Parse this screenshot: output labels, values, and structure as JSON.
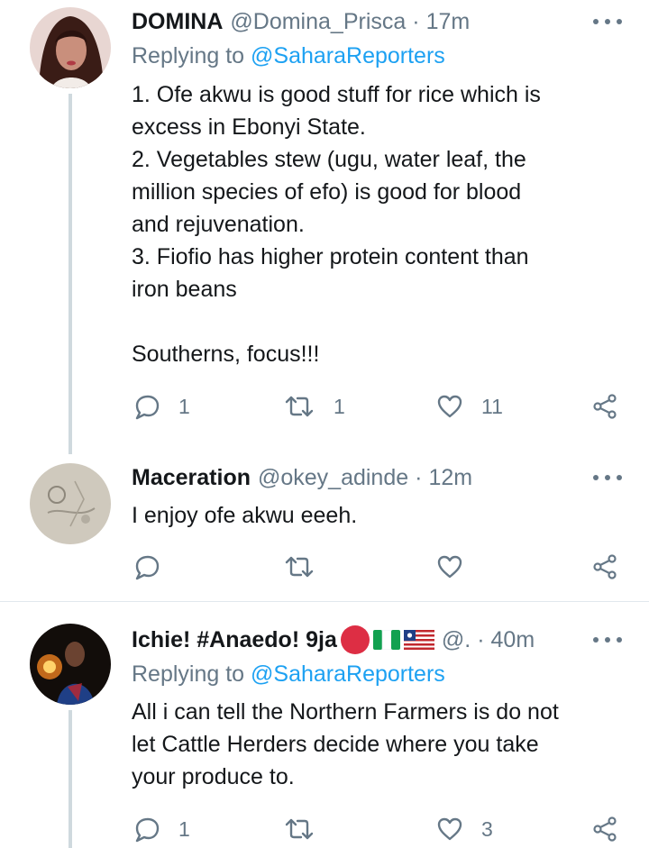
{
  "tweets": [
    {
      "name": "DOMINA",
      "handle": "@Domina_Prisca",
      "dot": "·",
      "time": "17m",
      "reply_prefix": "Replying to",
      "reply_mention": "@SaharaReporters",
      "text_lines": [
        "1. Ofe akwu is good stuff for rice which is",
        "excess in Ebonyi State.",
        "2. Vegetables stew (ugu, water leaf, the",
        "million species of efo) is good for blood",
        "and rejuvenation.",
        "3. Fiofio has higher protein content than",
        "iron beans",
        "",
        "Southerns, focus!!!"
      ],
      "replies": "1",
      "retweets": "1",
      "likes": "11"
    },
    {
      "name": "Maceration",
      "handle": "@okey_adinde",
      "dot": "·",
      "time": "12m",
      "text_lines": [
        "I enjoy ofe akwu eeeh."
      ],
      "replies": "",
      "retweets": "",
      "likes": ""
    },
    {
      "name": "Ichie! #Anaedo! 9ja",
      "handle": "@.",
      "dot": "·",
      "time": "40m",
      "reply_prefix": "Replying to",
      "reply_mention": "@SaharaReporters",
      "text_lines": [
        "All i can tell the Northern Farmers is do not",
        "let Cattle Herders decide where you take",
        "your produce to."
      ],
      "replies": "1",
      "retweets": "",
      "likes": "3"
    }
  ],
  "icons": {
    "reply": "reply-icon",
    "retweet": "retweet-icon",
    "like": "heart-icon",
    "share": "share-icon",
    "more": "more-dots-icon"
  },
  "colors": {
    "accent": "#1da1f2",
    "muted": "#657786",
    "text": "#14171a"
  }
}
